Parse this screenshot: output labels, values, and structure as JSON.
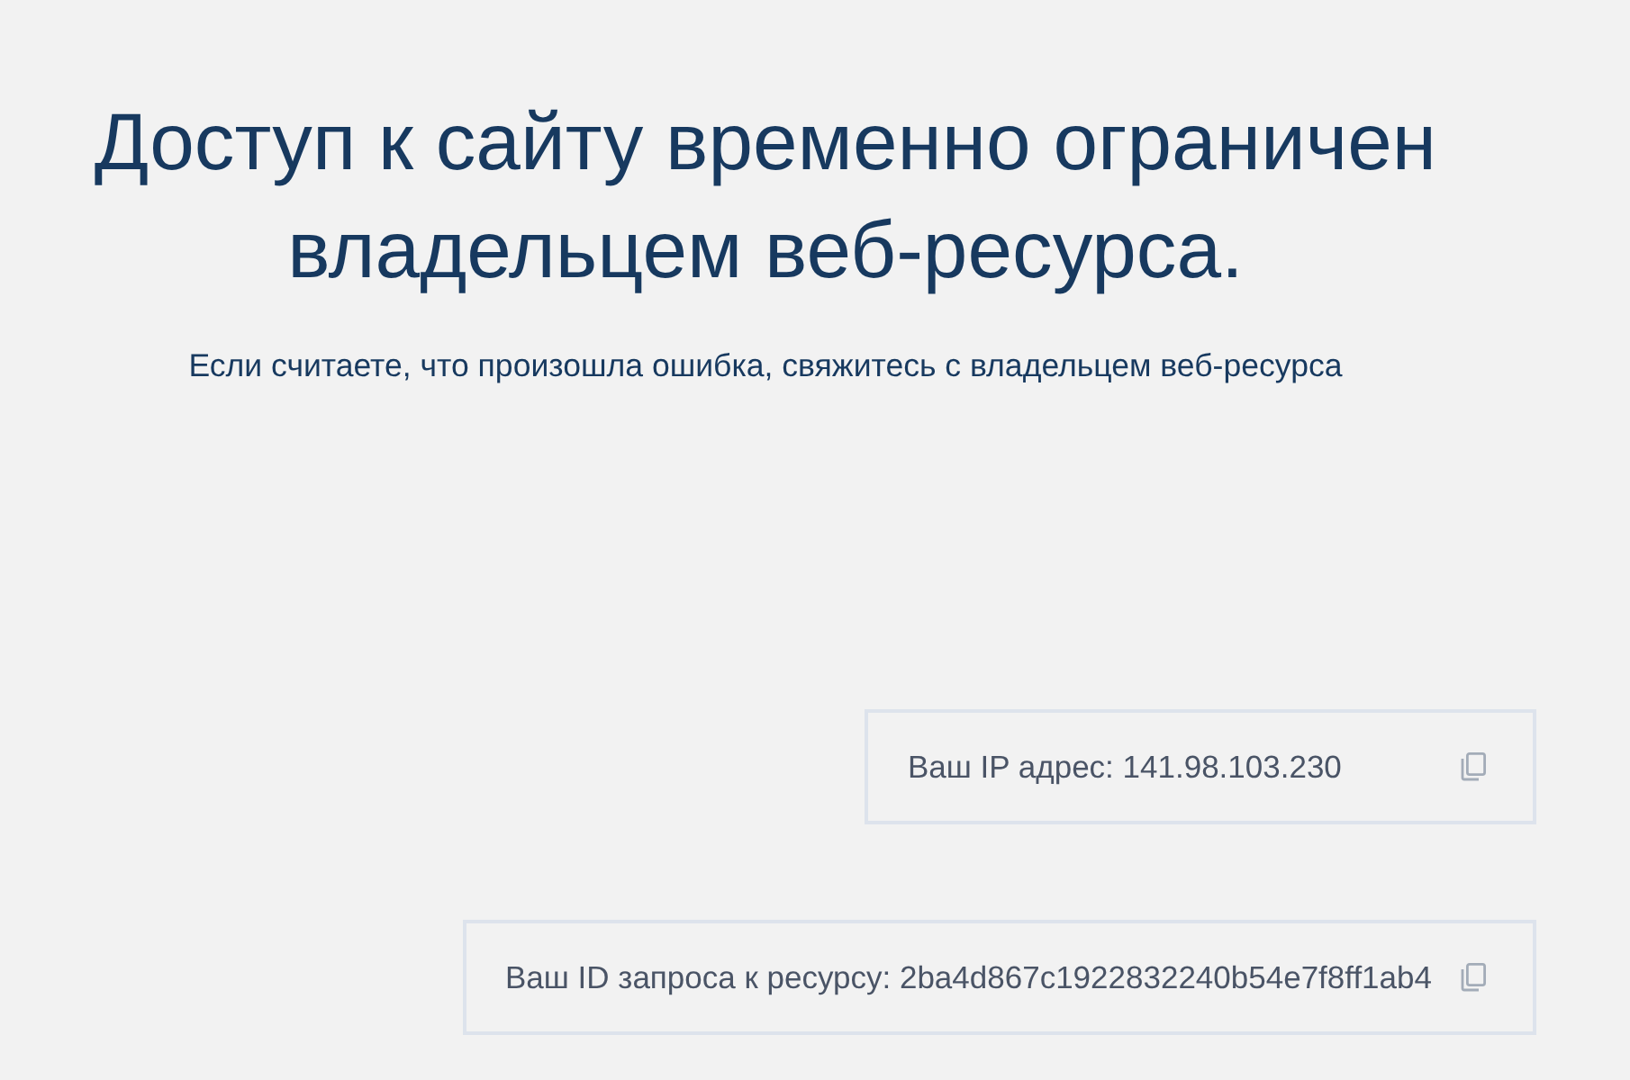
{
  "heading": "Доступ к сайту временно ограничен владельцем веб-ресурса.",
  "message": "Если считаете, что произошла ошибка, свяжитесь с владельцем веб-ресурса",
  "info_boxes": [
    {
      "text": "Ваш IP адрес: 141.98.103.230"
    },
    {
      "text": "Ваш ID запроса к ресурсу: 2ba4d867c1922832240b54e7f8ff1ab4"
    }
  ]
}
